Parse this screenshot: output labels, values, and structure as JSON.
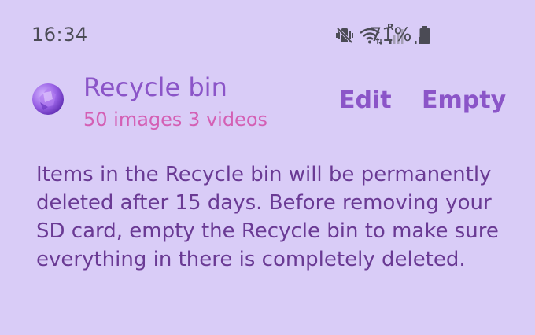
{
  "status_bar": {
    "time": "16:34",
    "battery_percent": "71%",
    "roaming_indicator": "R",
    "icons": [
      "mute-vibrate-icon",
      "wifi-icon",
      "signal-icon",
      "signal-icon",
      "battery-icon"
    ]
  },
  "header": {
    "title": "Recycle bin",
    "subtitle": "50 images 3 videos",
    "edit_label": "Edit",
    "empty_label": "Empty"
  },
  "notice": {
    "text": "Items in the Recycle bin will be permanently deleted after 15 days. Before removing your SD card, empty the Recycle bin to make sure everything in there is completely deleted."
  },
  "colors": {
    "background": "#d9ccf7",
    "accent": "#8b55c8",
    "subtitle": "#d45fb4",
    "body_text": "#6a3a94",
    "status_text": "#4b4b55"
  }
}
